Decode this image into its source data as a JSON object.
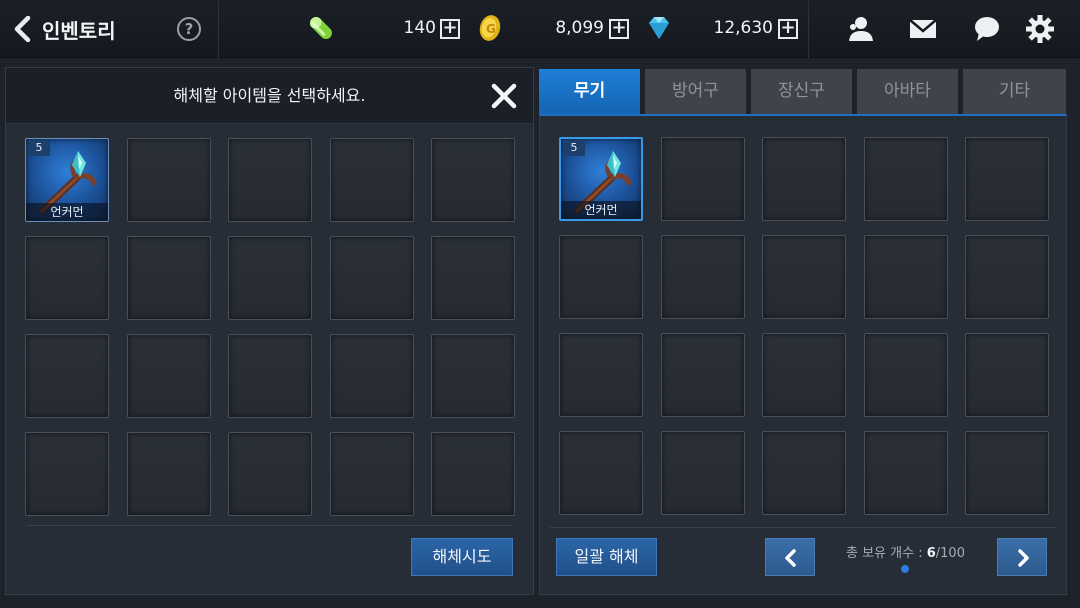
{
  "header": {
    "title": "인벤토리",
    "help_label": "?",
    "stamina": {
      "icon": "energy-capsule-icon",
      "value": "140"
    },
    "gold": {
      "icon": "gold-coin-icon",
      "value": "8,099"
    },
    "gems": {
      "icon": "diamond-icon",
      "value": "12,630"
    },
    "plus_label": "+",
    "right_icons": [
      "friends-icon",
      "mail-icon",
      "chat-icon",
      "settings-icon"
    ]
  },
  "dismantle_panel": {
    "prompt": "해체할 아이템을 선택하세요.",
    "slots": [
      {
        "level": "5",
        "name": "언커먼",
        "icon": "staff-weapon-icon"
      }
    ],
    "total_slots": 20,
    "action_label": "해체시도"
  },
  "inventory_panel": {
    "tabs": [
      {
        "label": "무기",
        "active": true
      },
      {
        "label": "방어구",
        "active": false
      },
      {
        "label": "장신구",
        "active": false
      },
      {
        "label": "아바타",
        "active": false
      },
      {
        "label": "기타",
        "active": false
      }
    ],
    "slots": [
      {
        "level": "5",
        "name": "언커먼",
        "icon": "staff-weapon-icon",
        "selected": true
      }
    ],
    "total_slots": 20,
    "bulk_label": "일괄 해체",
    "count_label": "총 보유 개수 : ",
    "count_current": "6",
    "count_max": "/100"
  },
  "colors": {
    "accent_blue": "#1f7fd6",
    "background": "#1e232b",
    "panel": "#272d36"
  }
}
